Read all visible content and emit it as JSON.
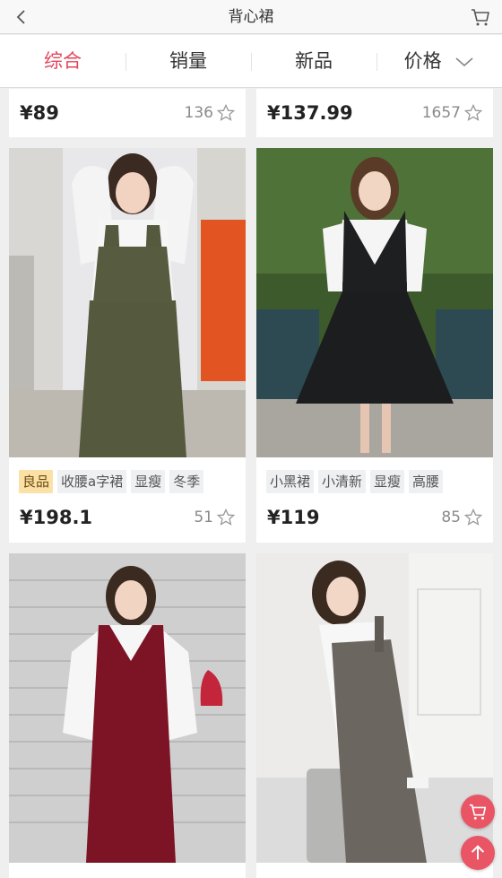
{
  "header": {
    "title": "背心裙",
    "back_icon": "chevron-left-icon",
    "cart_icon": "cart-icon"
  },
  "sort_tabs": [
    {
      "label": "综合",
      "active": true
    },
    {
      "label": "销量",
      "active": false
    },
    {
      "label": "新品",
      "active": false
    },
    {
      "label": "价格",
      "active": false,
      "icon": "chevron-down-icon"
    }
  ],
  "products": [
    {
      "price": "¥89",
      "likes": "136",
      "tags": []
    },
    {
      "price": "¥137.99",
      "likes": "1657",
      "tags": []
    },
    {
      "price": "¥198.1",
      "likes": "51",
      "tags": [
        {
          "text": "良品",
          "highlight": true
        },
        {
          "text": "收腰a字裙"
        },
        {
          "text": "显瘦"
        },
        {
          "text": "冬季"
        }
      ]
    },
    {
      "price": "¥119",
      "likes": "85",
      "tags": [
        {
          "text": "小黑裙"
        },
        {
          "text": "小清新"
        },
        {
          "text": "显瘦"
        },
        {
          "text": "高腰"
        }
      ]
    },
    {
      "price": "",
      "likes": "",
      "tags": []
    },
    {
      "price": "",
      "likes": "",
      "tags": []
    }
  ],
  "colors": {
    "accent": "#e4455b",
    "float_button": "#e95565",
    "tag_bg": "#eef0f1",
    "tag_highlight_bg": "#fbe1a6"
  },
  "floating_buttons": [
    "cart-icon",
    "arrow-up-icon"
  ]
}
